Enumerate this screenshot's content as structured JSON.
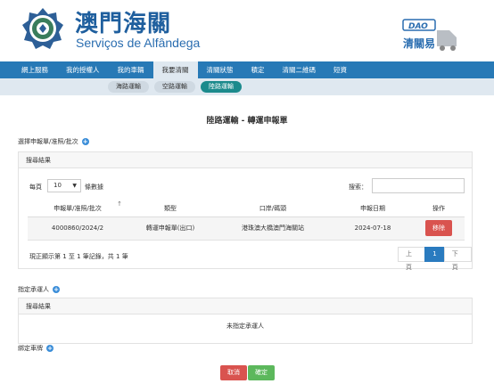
{
  "header": {
    "title_cn": "澳門海關",
    "title_pt": "Serviços de Alfândega",
    "dao_brand": "DAO",
    "dao_sub": "清關易"
  },
  "nav": {
    "items": [
      "網上服務",
      "我的授權人",
      "我的車輛",
      "我要清關",
      "清關狀態",
      "積定",
      "清關二維碼",
      "短資"
    ],
    "active_index": 3
  },
  "subnav": {
    "items": [
      "海路運輸",
      "空路運輸",
      "陸路運輸"
    ],
    "active_index": 2
  },
  "page": {
    "title": "陸路運輸 - 轉運申報單"
  },
  "section1": {
    "label": "選擇申報單/准照/批次",
    "panel_title": "搜尋結果",
    "page_size_prefix": "每頁",
    "page_size_value": "10",
    "page_size_suffix": "條數據",
    "search_label": "搜索：",
    "search_value": "",
    "columns": [
      "申報單/准照/批次",
      "類型",
      "口岸/碼頭",
      "申報日期",
      "操作"
    ],
    "rows": [
      {
        "ref": "4000860/2024/2",
        "type": "轉運申報單(出口)",
        "port": "港珠澳大橋澳門海關站",
        "date": "2024-07-18",
        "action": "移除"
      }
    ],
    "info": "現正顯示第 1 至 1 筆記錄，共 1 筆",
    "pager": {
      "prev": "上頁",
      "current": "1",
      "next": "下頁"
    }
  },
  "section2": {
    "label": "指定承運人",
    "panel_title": "搜尋結果",
    "empty_text": "未指定承運人"
  },
  "section3": {
    "label": "綁定車牌"
  },
  "actions": {
    "cancel": "取消",
    "confirm": "確定"
  },
  "colors": {
    "nav_bg": "#2779b6",
    "accent": "#1b8a8c",
    "danger": "#d9534f",
    "success": "#5cb85c",
    "brand_blue": "#1f5f9e"
  }
}
